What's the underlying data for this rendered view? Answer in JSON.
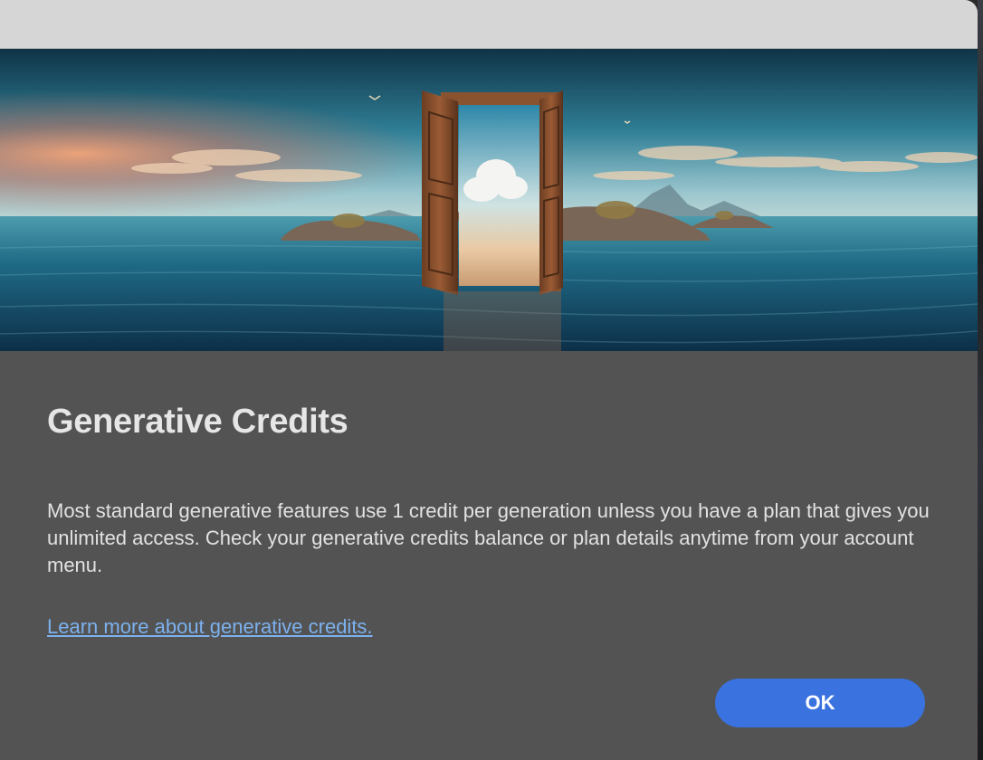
{
  "dialog": {
    "title": "Generative Credits",
    "body": "Most standard generative features use 1 credit per generation unless you have a plan that gives you unlimited access. Check your generative credits balance or plan details anytime from your account menu.",
    "link_label": "Learn more about generative credits.",
    "ok_label": "OK"
  },
  "colors": {
    "dialog_bg": "#535353",
    "titlebar_bg": "#d6d6d6",
    "link": "#7cb1ee",
    "primary_button": "#3a72e0"
  }
}
